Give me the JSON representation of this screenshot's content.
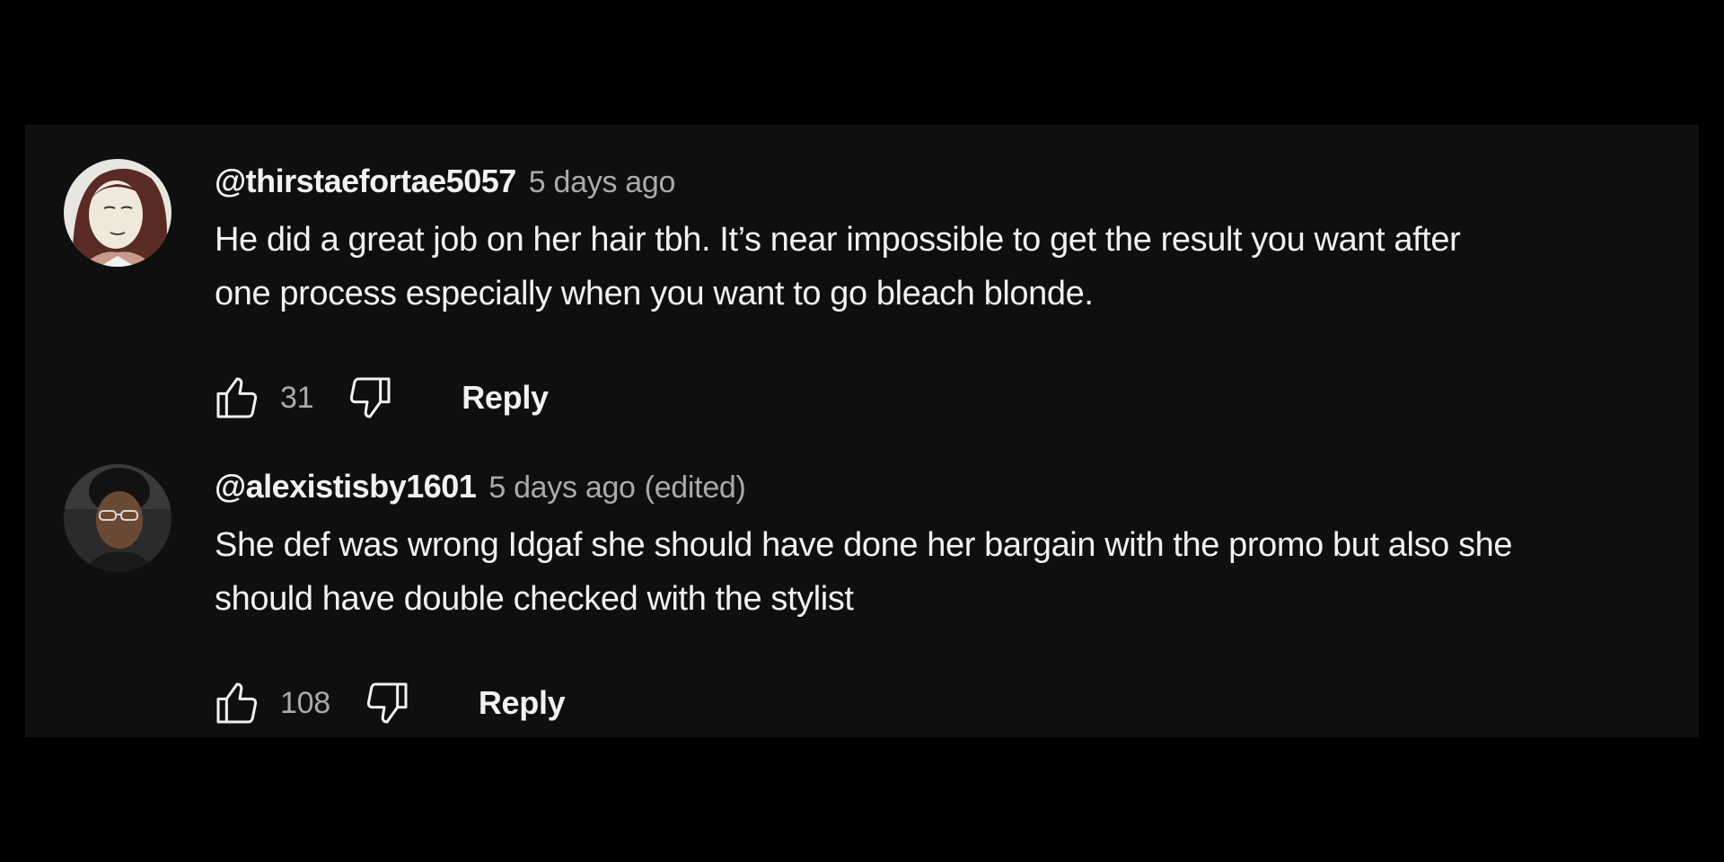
{
  "comments": [
    {
      "author": "@thirstaefortae5057",
      "time": "5 days ago",
      "edited": "",
      "text_lines": [
        "He did a great job on her hair tbh. It’s near impossible to get the result you want after",
        "one process especially when you want to go bleach blonde."
      ],
      "likes": "31",
      "reply_label": "Reply"
    },
    {
      "author": "@alexistisby1601",
      "time": "5 days ago",
      "edited": "(edited)",
      "text_lines": [
        "She def was wrong Idgaf she should have done her bargain with the promo but also she",
        "should have double checked with the stylist"
      ],
      "likes": "108",
      "reply_label": "Reply"
    }
  ],
  "icons": {
    "like": "thumbs-up-icon",
    "dislike": "thumbs-down-icon"
  },
  "colors": {
    "background": "#000000",
    "panel": "#0f0f0f",
    "text_primary": "#f1f1f1",
    "text_secondary": "#aaaaaa"
  }
}
